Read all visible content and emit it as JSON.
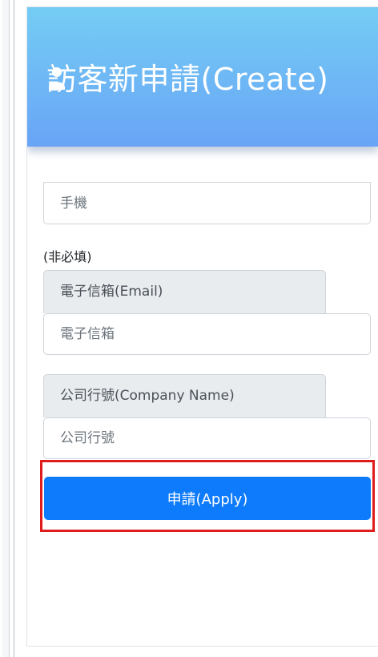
{
  "header": {
    "title": "訪客新申請(Create)",
    "icon": "user-plus-icon"
  },
  "form": {
    "phone_placeholder": "手機",
    "optional_note": "(非必填)",
    "email_label": "電子信箱(Email)",
    "email_placeholder": "電子信箱",
    "company_label": "公司行號(Company Name)",
    "company_placeholder": "公司行號",
    "apply_label": "申請(Apply)"
  },
  "colors": {
    "header_gradient_top": "#74cdf4",
    "header_gradient_bottom": "#69a4f6",
    "apply_button": "#0d7bfb",
    "highlight_border": "#e01b1b",
    "addon_background": "#e9ecef"
  }
}
